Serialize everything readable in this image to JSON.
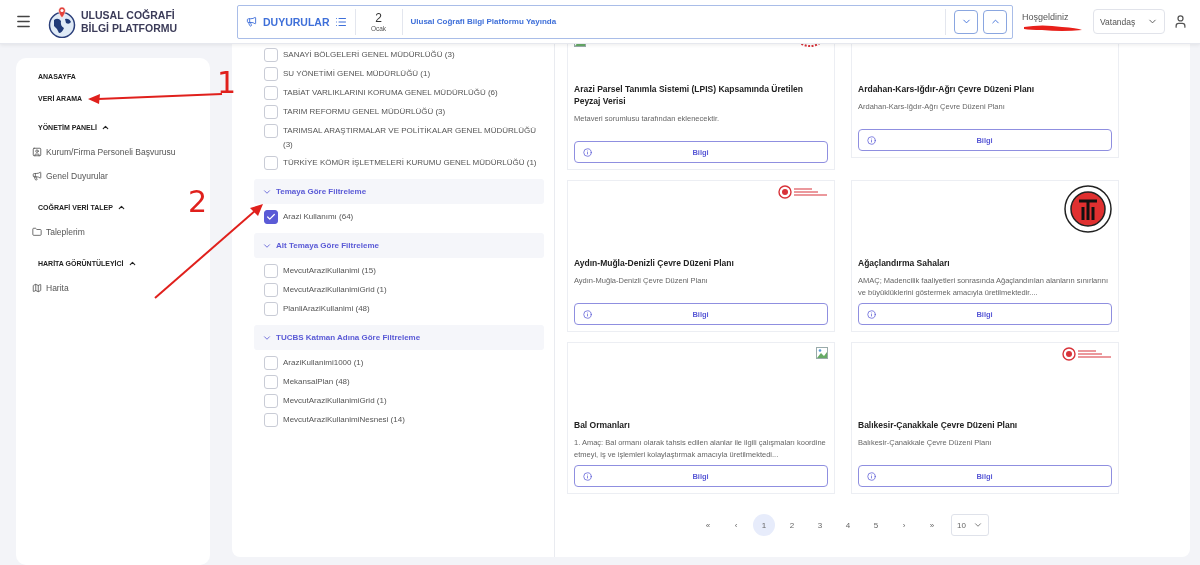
{
  "header": {
    "title_lines": [
      "ULUSAL COĞRAFİ",
      "BİLGİ PLATFORMU"
    ],
    "announcements": {
      "label": "DUYURULAR",
      "day": "2",
      "month": "Ocak",
      "text": "Ulusal Coğrafi Bilgi Platformu Yayında"
    },
    "welcome": "Hoşgeldiniz",
    "role_select": {
      "value": "Vatandaş"
    }
  },
  "sidebar": {
    "items": [
      {
        "kind": "link",
        "label": "ANASAYFA"
      },
      {
        "kind": "link",
        "label": "VERİ ARAMA"
      },
      {
        "kind": "section",
        "label": "YÖNETİM PANELİ",
        "expanded": true,
        "children": [
          {
            "label": "Kurum/Firma Personeli Başvurusu"
          },
          {
            "label": "Genel Duyurular"
          }
        ]
      },
      {
        "kind": "section",
        "label": "COĞRAFİ VERİ TALEP",
        "expanded": true,
        "children": [
          {
            "label": "Taleplerim"
          }
        ]
      },
      {
        "kind": "section",
        "label": "HARİTA GÖRÜNTÜLEYİCİ",
        "expanded": true,
        "children": [
          {
            "label": "Harita"
          }
        ]
      }
    ]
  },
  "filter_groups": [
    {
      "options": [
        {
          "label": "SANAYİ BÖLGELERİ GENEL MÜDÜRLÜĞÜ (3)",
          "checked": false
        },
        {
          "label": "SU YÖNETİMİ GENEL MÜDÜRLÜĞÜ (1)",
          "checked": false
        },
        {
          "label": "TABİAT VARLIKLARINI KORUMA GENEL MÜDÜRLÜĞÜ (6)",
          "checked": false
        },
        {
          "label": "TARIM REFORMU GENEL MÜDÜRLÜĞÜ (3)",
          "checked": false
        },
        {
          "label": "TARIMSAL ARAŞTIRMALAR VE POLİTİKALAR GENEL MÜDÜRLÜĞÜ (3)",
          "checked": false
        },
        {
          "label": "TÜRKİYE KÖMÜR İŞLETMELERİ KURUMU GENEL MÜDÜRLÜĞÜ (1)",
          "checked": false
        }
      ]
    },
    {
      "title": "Temaya Göre Filtreleme",
      "expanded": true,
      "options": [
        {
          "label": "Arazi Kullanımı (64)",
          "checked": true
        }
      ]
    },
    {
      "title": "Alt Temaya Göre Filtreleme",
      "expanded": true,
      "options": [
        {
          "label": "MevcutAraziKullanimi (15)",
          "checked": false
        },
        {
          "label": "MevcutAraziKullanimiGrid (1)",
          "checked": false
        },
        {
          "label": "PlanliAraziKullanimi (48)",
          "checked": false
        }
      ]
    },
    {
      "title": "TUCBS Katman Adına Göre Filtreleme",
      "expanded": true,
      "options": [
        {
          "label": "AraziKullanimi1000 (1)",
          "checked": false
        },
        {
          "label": "MekansalPlan (48)",
          "checked": false
        },
        {
          "label": "MevcutAraziKullanimiGrid (1)",
          "checked": false
        },
        {
          "label": "MevcutAraziKullanimiNesnesi (14)",
          "checked": false
        }
      ]
    }
  ],
  "cards": [
    {
      "title": "Arazi Parsel Tanımla Sistemi (LPIS) Kapsamında Üretilen Peyzaj Verisi",
      "description": "Metaveri sorumlusu tarafından eklenecektir.",
      "marks": [
        {
          "kind": "broken"
        },
        {
          "kind": "seal"
        }
      ],
      "button": "Bilgi"
    },
    {
      "title": "Ardahan-Kars-Iğdır-Ağrı Çevre Düzeni Planı",
      "description": "Ardahan-Kars-Iğdır-Ağrı Çevre Düzeni Planı",
      "button": "Bilgi"
    },
    {
      "title": "Aydın-Muğla-Denizli Çevre Düzeni Planı",
      "description": "Aydın-Muğla-Denizli Çevre Düzeni Planı",
      "marks": [
        {
          "kind": "seal-wide"
        }
      ],
      "button": "Bilgi"
    },
    {
      "title": "Ağaçlandırma Sahaları",
      "description": "AMAÇ; Madencilik faaliyetleri sonrasında Ağaçlandırılan alanların sınırlarını ve büyüklüklerini göstermek amacıyla üretilmektedir....",
      "marks": [
        {
          "kind": "ring"
        }
      ],
      "button": "Bilgi"
    },
    {
      "title": "Bal Ormanları",
      "description": "1. Amaç: Bal ormanı olarak tahsis edilen alanlar ile ilgili çalışmaları koordine etmeyi, iş ve işlemleri kolaylaştırmak amacıyla üretilmektedi...",
      "marks": [
        {
          "kind": "broken"
        }
      ],
      "button": "Bilgi"
    },
    {
      "title": "Balıkesir-Çanakkale Çevre Düzeni Planı",
      "description": "Balıkesir-Çanakkale Çevre Düzeni Planı",
      "marks": [
        {
          "kind": "seal-wide"
        }
      ],
      "button": "Bilgi"
    }
  ],
  "pagination": {
    "first": "«",
    "prev": "‹",
    "pages": [
      {
        "label": "1",
        "selected": true
      },
      {
        "label": "2",
        "selected": false
      },
      {
        "label": "3",
        "selected": false
      },
      {
        "label": "4",
        "selected": false
      },
      {
        "label": "5",
        "selected": false
      }
    ],
    "next": "›",
    "last": "»",
    "page_size": "10"
  },
  "annotations": [
    {
      "label": "1"
    },
    {
      "label": "2"
    }
  ]
}
